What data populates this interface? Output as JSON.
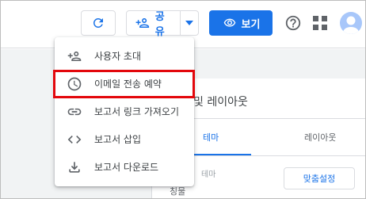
{
  "toolbar": {
    "refresh_icon": "refresh-icon",
    "share": {
      "label": "공유",
      "icon": "person-add-icon",
      "caret_icon": "caret-down-icon"
    },
    "view": {
      "label": "보기",
      "icon": "eye-icon"
    },
    "help_icon": "help-icon",
    "apps_icon": "apps-grid-icon",
    "avatar_icon": "avatar-icon"
  },
  "panel": {
    "title": "및 레이아웃",
    "tabs": [
      "테마",
      "레이아웃"
    ],
    "faded_label": "테마",
    "row_label": "칭물",
    "custom_button": "맞춤설정"
  },
  "menu": {
    "items": [
      {
        "label": "사용자 초대",
        "icon": "person-add-icon"
      },
      {
        "label": "이메일 전송 예약",
        "icon": "clock-icon"
      },
      {
        "label": "보고서 링크 가져오기",
        "icon": "link-icon"
      },
      {
        "label": "보고서 삽입",
        "icon": "code-icon"
      },
      {
        "label": "보고서 다운로드",
        "icon": "download-icon"
      }
    ]
  },
  "colors": {
    "accent": "#1a73e8",
    "highlight": "#e3070c",
    "icon": "#5f6368"
  }
}
